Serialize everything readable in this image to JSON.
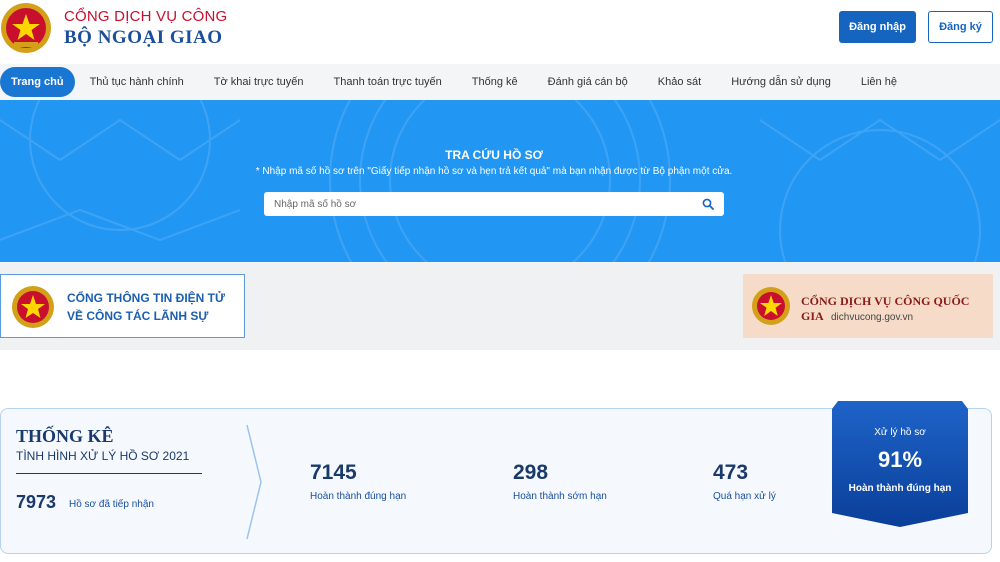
{
  "header": {
    "brand_top": "CỔNG DỊCH VỤ CÔNG",
    "brand_main": "BỘ NGOẠI GIAO",
    "login_label": "Đăng nhập",
    "register_label": "Đăng ký"
  },
  "nav": {
    "items": [
      {
        "label": "Trang chủ",
        "active": true
      },
      {
        "label": "Thủ tục hành chính"
      },
      {
        "label": "Tờ khai trực tuyến"
      },
      {
        "label": "Thanh toán trực tuyến"
      },
      {
        "label": "Thống kê"
      },
      {
        "label": "Đánh giá cán bộ"
      },
      {
        "label": "Khảo sát"
      },
      {
        "label": "Hướng dẫn sử dụng"
      },
      {
        "label": "Liên hệ"
      }
    ]
  },
  "search": {
    "title": "TRA CỨU HỒ SƠ",
    "note": "* Nhập mã số hồ sơ trên \"Giấy tiếp nhận hồ sơ và hẹn trả kết quả\" mà bạn nhận được từ Bộ phận một cửa.",
    "placeholder": "Nhập mã số hồ sơ"
  },
  "banners": {
    "left": {
      "line1": "CỔNG THÔNG TIN ĐIỆN TỬ",
      "line2": "VỀ CÔNG TÁC LÃNH SỰ"
    },
    "right": {
      "line1": "CỔNG DỊCH VỤ CÔNG QUỐC GIA",
      "line2": "dichvucong.gov.vn"
    }
  },
  "stats": {
    "title": "THỐNG KÊ",
    "subtitle": "TÌNH HÌNH XỬ LÝ HỒ SƠ 2021",
    "received": {
      "value": "7973",
      "label": "Hồ sơ đã tiếp nhận"
    },
    "metrics": [
      {
        "value": "7145",
        "label": "Hoàn thành đúng hạn"
      },
      {
        "value": "298",
        "label": "Hoàn thành sớm hạn"
      },
      {
        "value": "473",
        "label": "Quá hạn xử lý"
      }
    ],
    "rate": {
      "title": "Xử lý hồ sơ",
      "value": "91%",
      "label": "Hoàn thành đúng hạn"
    }
  },
  "colors": {
    "primary": "#1565c0",
    "hero": "#2196f3",
    "brand_red": "#c8102e",
    "navy": "#1a3a6b"
  }
}
